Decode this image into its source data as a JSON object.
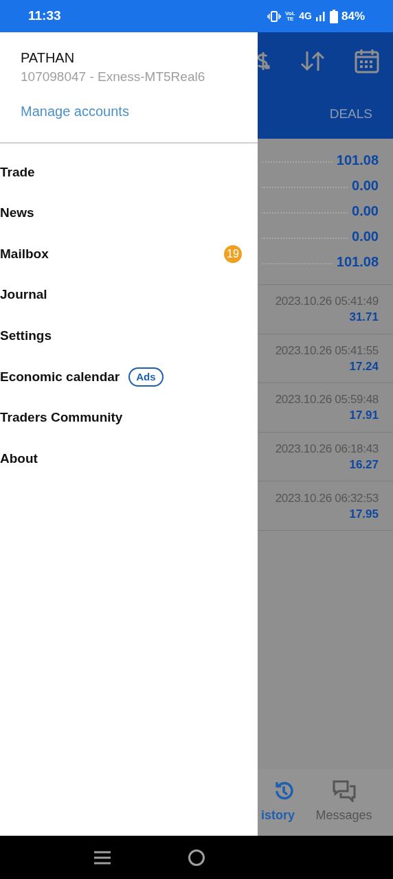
{
  "status_bar": {
    "time": "11:33",
    "volte": "VoLTE",
    "network": "4G",
    "battery": "84%"
  },
  "drawer": {
    "account_name": "PATHAN",
    "account_info": "107098047 - Exness-MT5Real6",
    "manage_link": "Manage accounts",
    "items": [
      {
        "label": "Trade"
      },
      {
        "label": "News"
      },
      {
        "label": "Mailbox",
        "badge": {
          "kind": "count",
          "text": "19"
        }
      },
      {
        "label": "Journal"
      },
      {
        "label": "Settings"
      },
      {
        "label": "Economic calendar",
        "badge": {
          "kind": "ad",
          "text": "Ads"
        }
      },
      {
        "label": "Traders Community"
      },
      {
        "label": "About"
      }
    ]
  },
  "background": {
    "tab": "DEALS",
    "summary": [
      "101.08",
      "0.00",
      "0.00",
      "0.00",
      "101.08"
    ],
    "deals": [
      {
        "time": "2023.10.26 05:41:49",
        "profit": "31.71"
      },
      {
        "time": "2023.10.26 05:41:55",
        "profit": "17.24"
      },
      {
        "time": "2023.10.26 05:59:48",
        "profit": "17.91"
      },
      {
        "time": "2023.10.26 06:18:43",
        "profit": "16.27"
      },
      {
        "time": "2023.10.26 06:32:53",
        "profit": "17.95"
      }
    ],
    "bottom_nav": [
      {
        "label": "istory",
        "kind": "history",
        "selected": true
      },
      {
        "label": "Messages",
        "kind": "messages",
        "selected": false
      }
    ]
  }
}
